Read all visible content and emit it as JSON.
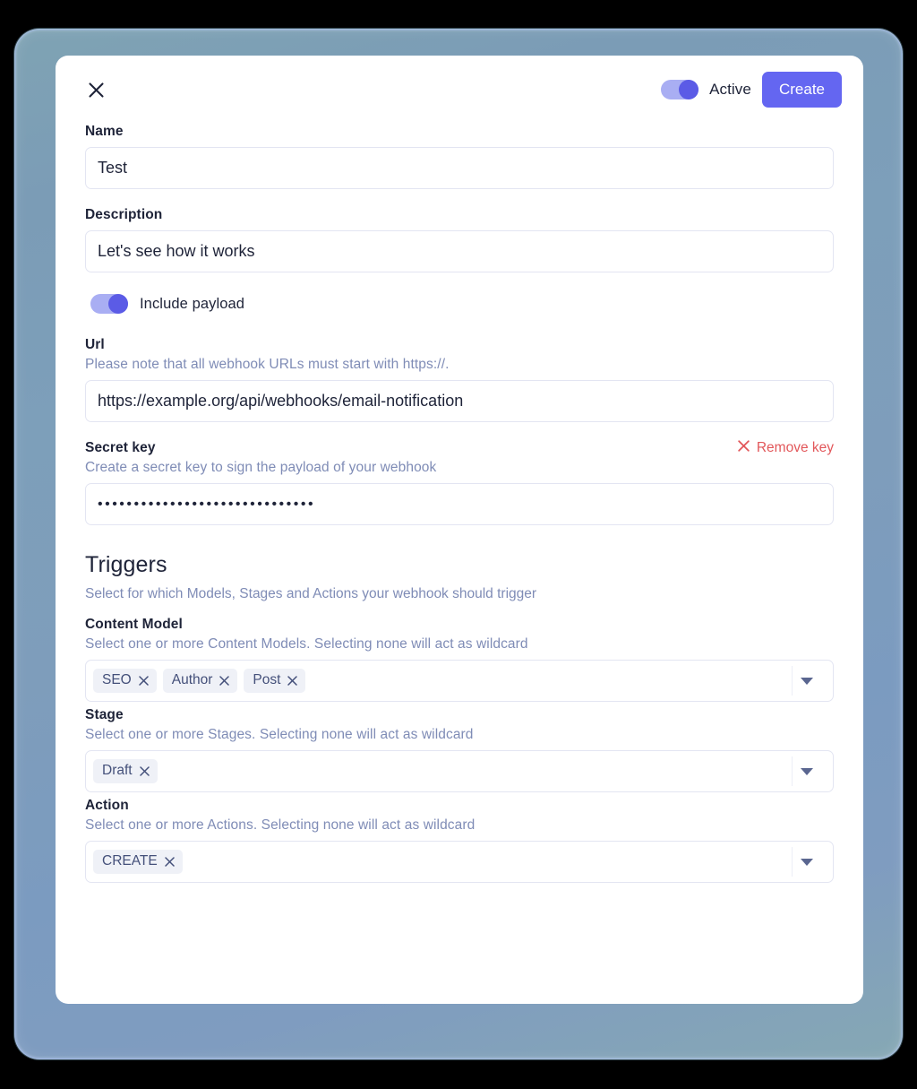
{
  "header": {
    "close_icon": "close-icon",
    "active_toggle_label": "Active",
    "active_toggle_state": "on",
    "create_label": "Create"
  },
  "form": {
    "name": {
      "label": "Name",
      "value": "Test",
      "placeholder": "Name"
    },
    "description": {
      "label": "Description",
      "value": "Let's see how it works",
      "placeholder": "Description"
    },
    "include_payload": {
      "label": "Include payload",
      "state": "on"
    },
    "url": {
      "label": "Url",
      "helper": "Please note that all webhook URLs must start with https://.",
      "value": "https://example.org/api/webhooks/email-notification",
      "placeholder": "https://"
    },
    "secret_key": {
      "label": "Secret key",
      "helper": "Create a secret key to sign the payload of your webhook",
      "remove_label": "Remove key",
      "remove_icon": "close-icon",
      "masked_value": "••••••••••••••••••••••••••••••"
    }
  },
  "triggers": {
    "title": "Triggers",
    "subtitle": "Select for which Models, Stages and Actions your webhook should trigger",
    "groups": [
      {
        "label": "Content Model",
        "helper": "Select one or more Content Models. Selecting none will act as wildcard",
        "chips": [
          "SEO",
          "Author",
          "Post"
        ],
        "caret_icon": "chevron-down-icon"
      },
      {
        "label": "Stage",
        "helper": "Select one or more Stages. Selecting none will act as wildcard",
        "chips": [
          "Draft"
        ],
        "caret_icon": "chevron-down-icon"
      },
      {
        "label": "Action",
        "helper": "Select one or more Actions. Selecting none will act as wildcard",
        "chips": [
          "CREATE"
        ],
        "caret_icon": "chevron-down-icon"
      }
    ]
  },
  "colors": {
    "accent": "#6466f1",
    "toggle_track": "#a9aef3",
    "toggle_knob": "#5b5be6",
    "danger": "#e2575a",
    "helper_text": "#7f8cb6",
    "chip_bg": "#eff1f7",
    "chip_text": "#44507a",
    "text": "#1e2338",
    "backdrop": "#7d9dba"
  }
}
